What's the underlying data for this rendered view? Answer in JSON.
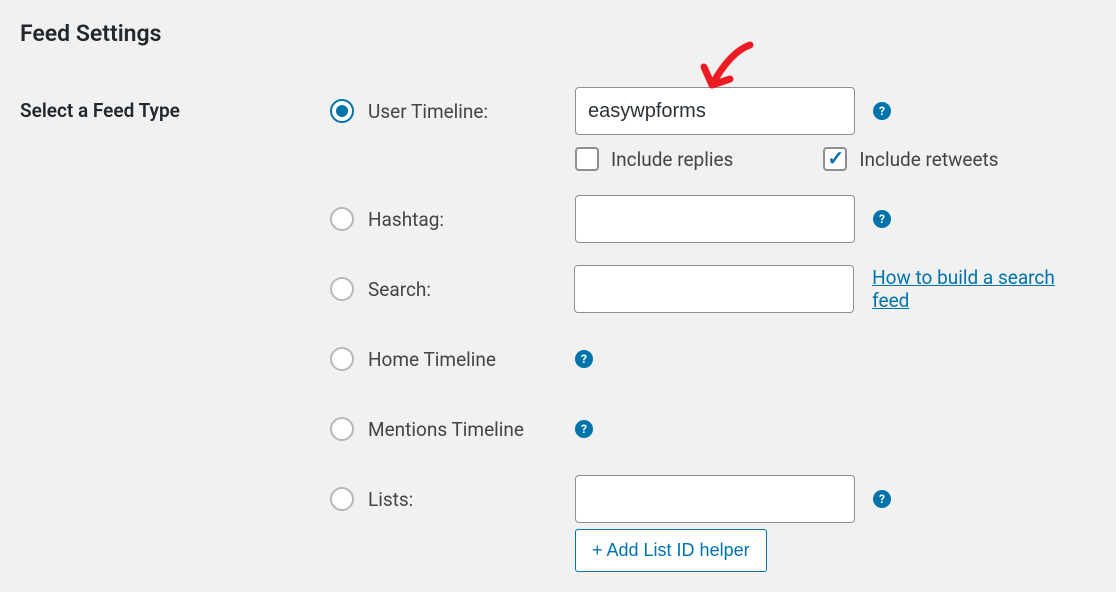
{
  "title": "Feed Settings",
  "sectionLabel": "Select a Feed Type",
  "options": {
    "userTimeline": {
      "label": "User Timeline:",
      "value": "easywpforms"
    },
    "includeReplies": {
      "label": "Include replies",
      "checked": false
    },
    "includeRetweets": {
      "label": "Include retweets",
      "checked": true
    },
    "hashtag": {
      "label": "Hashtag:",
      "value": ""
    },
    "search": {
      "label": "Search:",
      "value": "",
      "linkText": "How to build a search feed"
    },
    "homeTimeline": {
      "label": "Home Timeline"
    },
    "mentionsTimeline": {
      "label": "Mentions Timeline"
    },
    "lists": {
      "label": "Lists:",
      "value": "",
      "helperBtn": "+ Add List ID helper"
    }
  }
}
